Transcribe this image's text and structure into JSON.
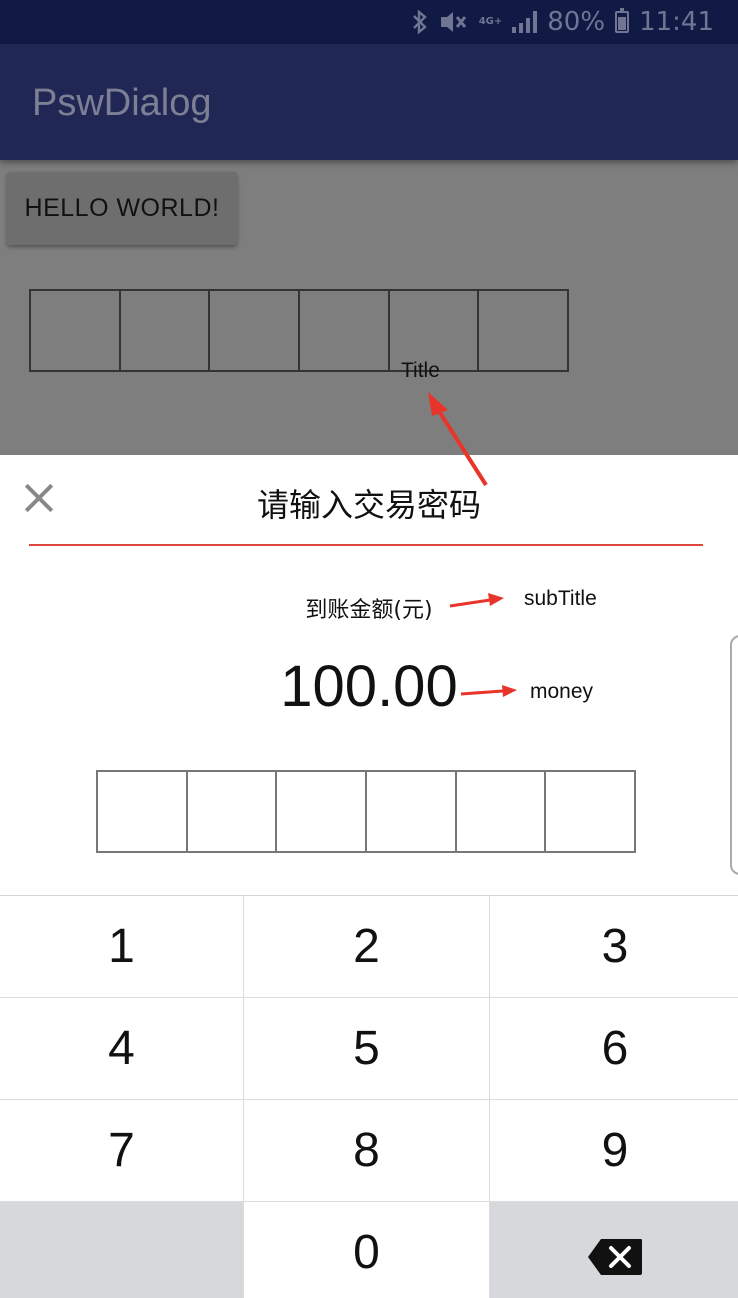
{
  "status_bar": {
    "battery": "80%",
    "time": "11:41",
    "network": "4G+",
    "icons": [
      "bluetooth-icon",
      "mute-vibrate-icon",
      "network-4g-icon",
      "signal-icon",
      "battery-icon"
    ]
  },
  "app_bar": {
    "title": "PswDialog"
  },
  "main": {
    "button_label": "HELLO WORLD!"
  },
  "annotations": {
    "title": "Title",
    "subtitle": "subTitle",
    "money": "money",
    "color": "#e8352a"
  },
  "dialog": {
    "title": "请输入交易密码",
    "subtitle": "到账金额(元)",
    "money": "100.00",
    "close_icon": "close-icon",
    "divider_color": "#e0453e"
  },
  "keypad": {
    "keys": [
      "1",
      "2",
      "3",
      "4",
      "5",
      "6",
      "7",
      "8",
      "9",
      "",
      "0",
      "⌫"
    ],
    "delete_icon": "backspace-icon"
  },
  "colors": {
    "status_bar": "#101a44",
    "app_bar": "#212755",
    "overlay": "#7e7e7e"
  }
}
